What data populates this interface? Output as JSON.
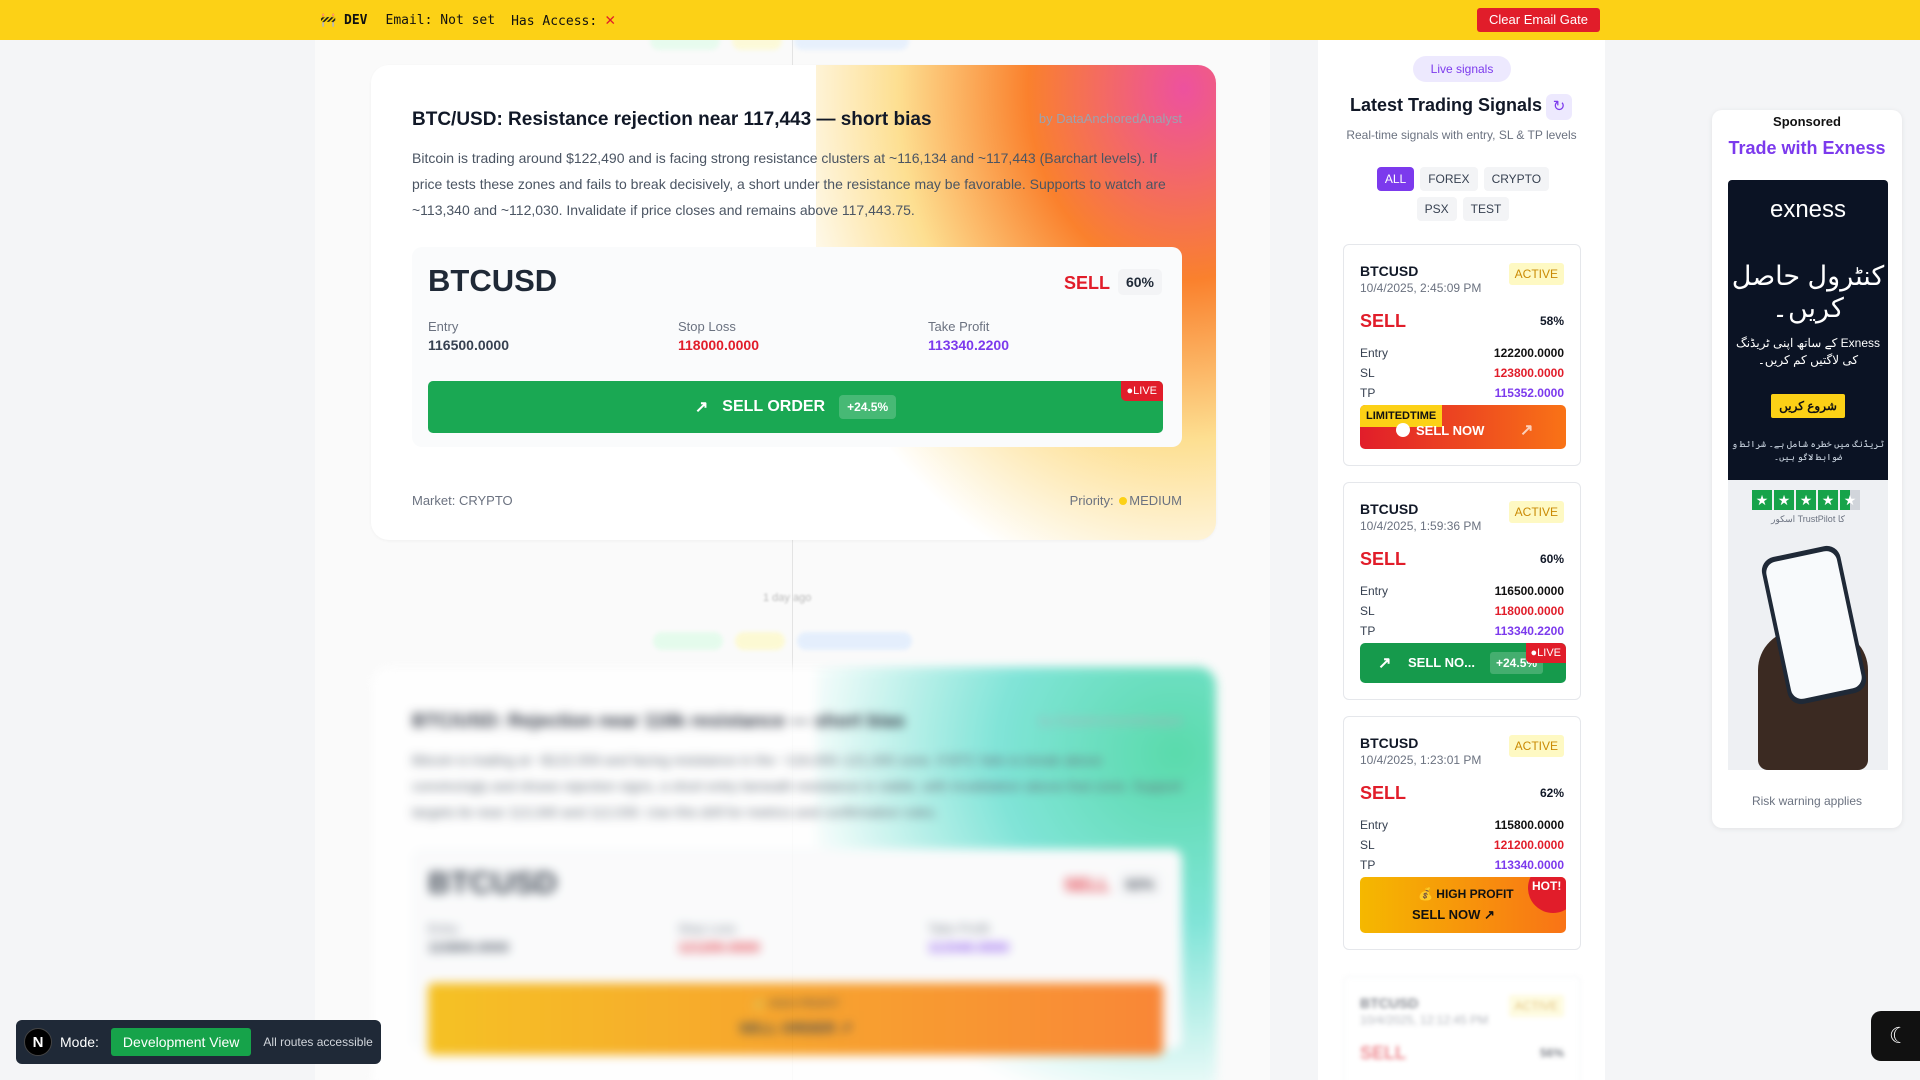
{
  "devbar": {
    "tag": "🚧 DEV",
    "email": "Email: Not set",
    "access": "Has Access:",
    "access_icon": "✕",
    "clear_label": "Clear Email Gate"
  },
  "feed": {
    "card1": {
      "title": "BTC/USD: Resistance rejection near 117,443 — short bias",
      "author": "by DataAnchoredAnalyst",
      "description": "Bitcoin is trading around $122,490 and is facing strong resistance clusters at ~116,134 and ~117,443 (Barchart levels). If price tests these zones and fails to break decisively, a short under the resistance may be favorable. Supports to watch are ~113,340 and ~112,030. Invalidate if price closes and remains above 117,443.75.",
      "symbol": "BTCUSD",
      "side": "SELL",
      "confidence": "60%",
      "entry_label": "Entry",
      "entry": "116500.0000",
      "sl_label": "Stop Loss",
      "sl": "118000.0000",
      "tp_label": "Take Profit",
      "tp": "113340.2200",
      "cta_label": "SELL ORDER",
      "cta_pct": "+24.5%",
      "live": "●LIVE",
      "market": "Market: CRYPTO",
      "priority_label": "Priority:",
      "priority": "MEDIUM"
    },
    "time_ago": "1 day ago",
    "card2": {
      "title": "BTC/USD: Rejection near 116k resistance — short bias",
      "author": "by DataAnchoredAnalyst",
      "description": "Bitcoin is trading at ~$122,559 and facing resistance in the ~116,000–121,000 zone. If BTC fails to break above convincingly and shows rejection signs, a short entry beneath resistance is viable, with invalidation above that zone. Support targets lie near 113,340 and 112,030. Use this drill for metrics and confirmation rules.",
      "symbol": "BTCUSD",
      "side": "SELL",
      "confidence": "62%",
      "entry_label": "Entry",
      "entry": "115800.0000",
      "sl_label": "Stop Loss",
      "sl": "121200.0000",
      "tp_label": "Take Profit",
      "tp": "113340.0000",
      "cta_top": "💰 HIGH PROFIT",
      "cta_label": "SELL ORDER ↗"
    }
  },
  "sidebar": {
    "live_pill": "Live signals",
    "title": "Latest Trading Signals",
    "subtitle": "Real-time signals with entry, SL & TP levels",
    "filters": [
      "ALL",
      "FOREX",
      "CRYPTO",
      "PSX",
      "TEST"
    ],
    "signals": [
      {
        "symbol": "BTCUSD",
        "time": "10/4/2025, 2:45:09 PM",
        "status": "ACTIVE",
        "side": "SELL",
        "confidence": "58%",
        "entry": "122200.0000",
        "sl": "123800.0000",
        "tp": "115352.0000",
        "cta_tag": "LIMITEDTIME",
        "cta": "SELL NOW"
      },
      {
        "symbol": "BTCUSD",
        "time": "10/4/2025, 1:59:36 PM",
        "status": "ACTIVE",
        "side": "SELL",
        "confidence": "60%",
        "entry": "116500.0000",
        "sl": "118000.0000",
        "tp": "113340.2200",
        "cta": "SELL NO...",
        "cta_pct": "+24.5%",
        "live": "●LIVE"
      },
      {
        "symbol": "BTCUSD",
        "time": "10/4/2025, 1:23:01 PM",
        "status": "ACTIVE",
        "side": "SELL",
        "confidence": "62%",
        "entry": "115800.0000",
        "sl": "121200.0000",
        "tp": "113340.0000",
        "cta_top": "💰 HIGH PROFIT",
        "cta": "SELL NOW ↗",
        "hot": "HOT!"
      },
      {
        "symbol": "BTCUSD",
        "time": "10/4/2025, 12:12:45 PM",
        "status": "ACTIVE",
        "side": "SELL",
        "confidence": "56%"
      }
    ],
    "labels": {
      "entry": "Entry",
      "sl": "SL",
      "tp": "TP"
    }
  },
  "ad": {
    "sponsored": "Sponsored",
    "headline": "Trade with Exness",
    "brand": "exness",
    "urdu_headline": "کنٹرول حاصل کریں۔",
    "urdu_body": "Exness کے ساتھ اپنی ٹریڈنگ کی لاگتیں کم کریں۔",
    "urdu_cta": "شروع کریں",
    "urdu_note": "ٹریڈنگ میں خطرہ شامل ہے۔ شرائط و ضوابط لاگو ہیں۔",
    "trustpilot": "کا TrustPilot اسکور",
    "risk": "Risk warning applies"
  },
  "modebar": {
    "logo": "N",
    "label": "Mode:",
    "mode": "Development View",
    "access": "All routes accessible"
  },
  "colors": {
    "accent": "#7c3aed",
    "sell": "#e11d2a",
    "buy_green": "#16a34a",
    "dev_yellow": "#fcd116"
  }
}
